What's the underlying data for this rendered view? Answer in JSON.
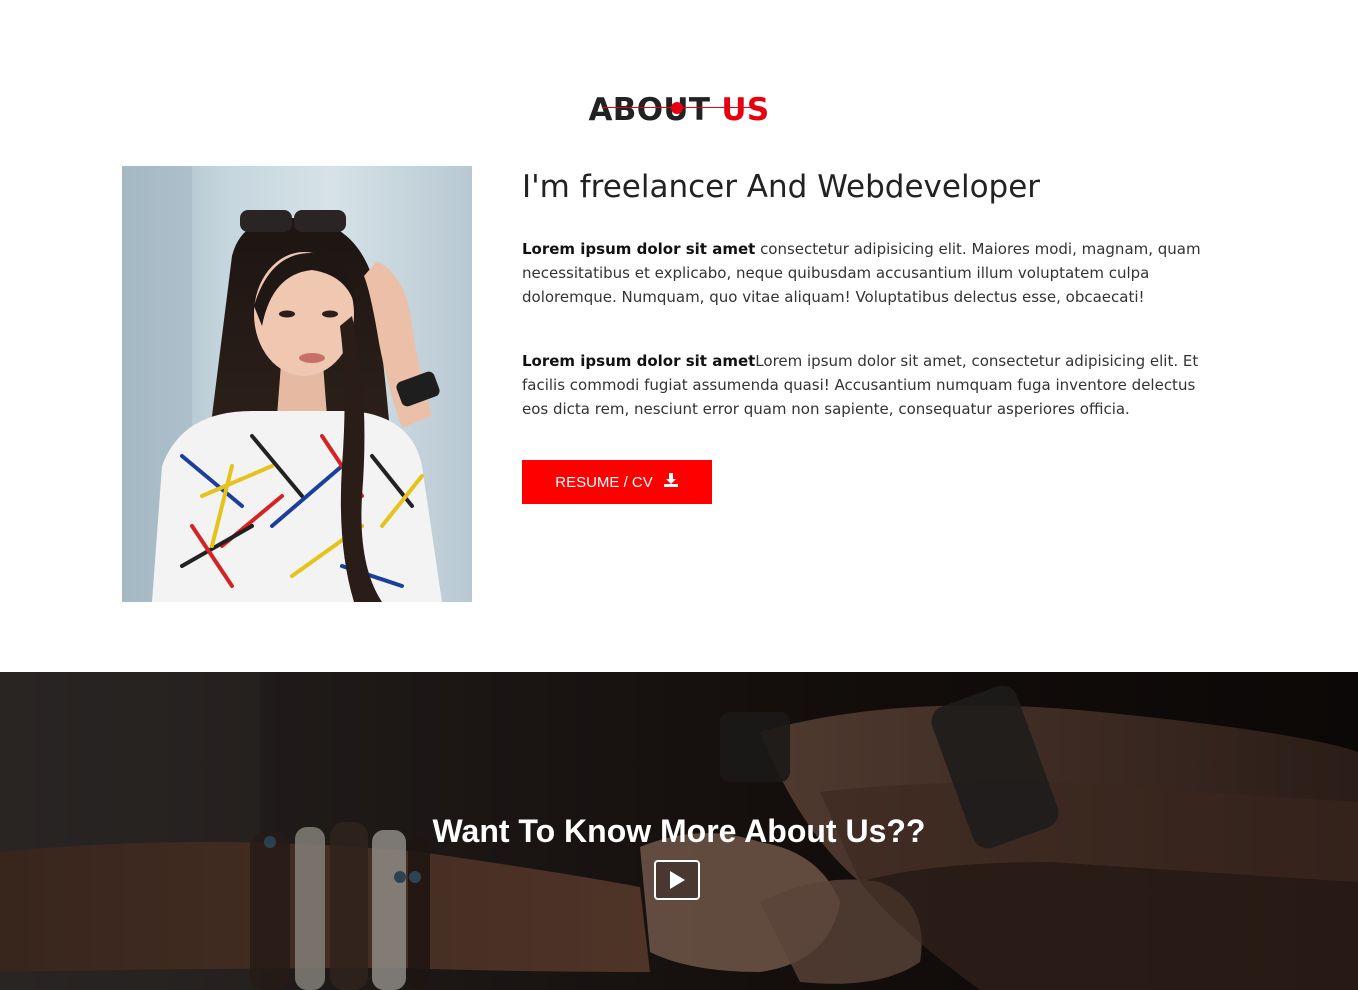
{
  "about": {
    "title_main": "ABOUT",
    "title_accent": "US",
    "headline": "I'm freelancer And Webdeveloper",
    "para1_bold": "Lorem ipsum dolor sit amet",
    "para1_text": " consectetur adipisicing elit. Maiores modi, magnam, quam necessitatibus et explicabo, neque quibusdam accusantium illum voluptatem culpa doloremque. Numquam, quo vitae aliquam! Voluptatibus delectus esse, obcaecati!",
    "para2_bold": "Lorem ipsum dolor sit amet",
    "para2_text": "Lorem ipsum dolor sit amet, consectetur adipisicing elit. Et facilis commodi fugiat assumenda quasi! Accusantium numquam fuga inventore delectus eos dicta rem, nesciunt error quam non sapiente, consequatur asperiores officia.",
    "resume_label": "RESUME / CV",
    "resume_icon": "download-icon"
  },
  "cta": {
    "title": "Want To Know More About Us??",
    "play_icon": "play-icon"
  },
  "colors": {
    "accent": "#e8000e",
    "button": "#ff0000",
    "text_dark": "#222222"
  }
}
